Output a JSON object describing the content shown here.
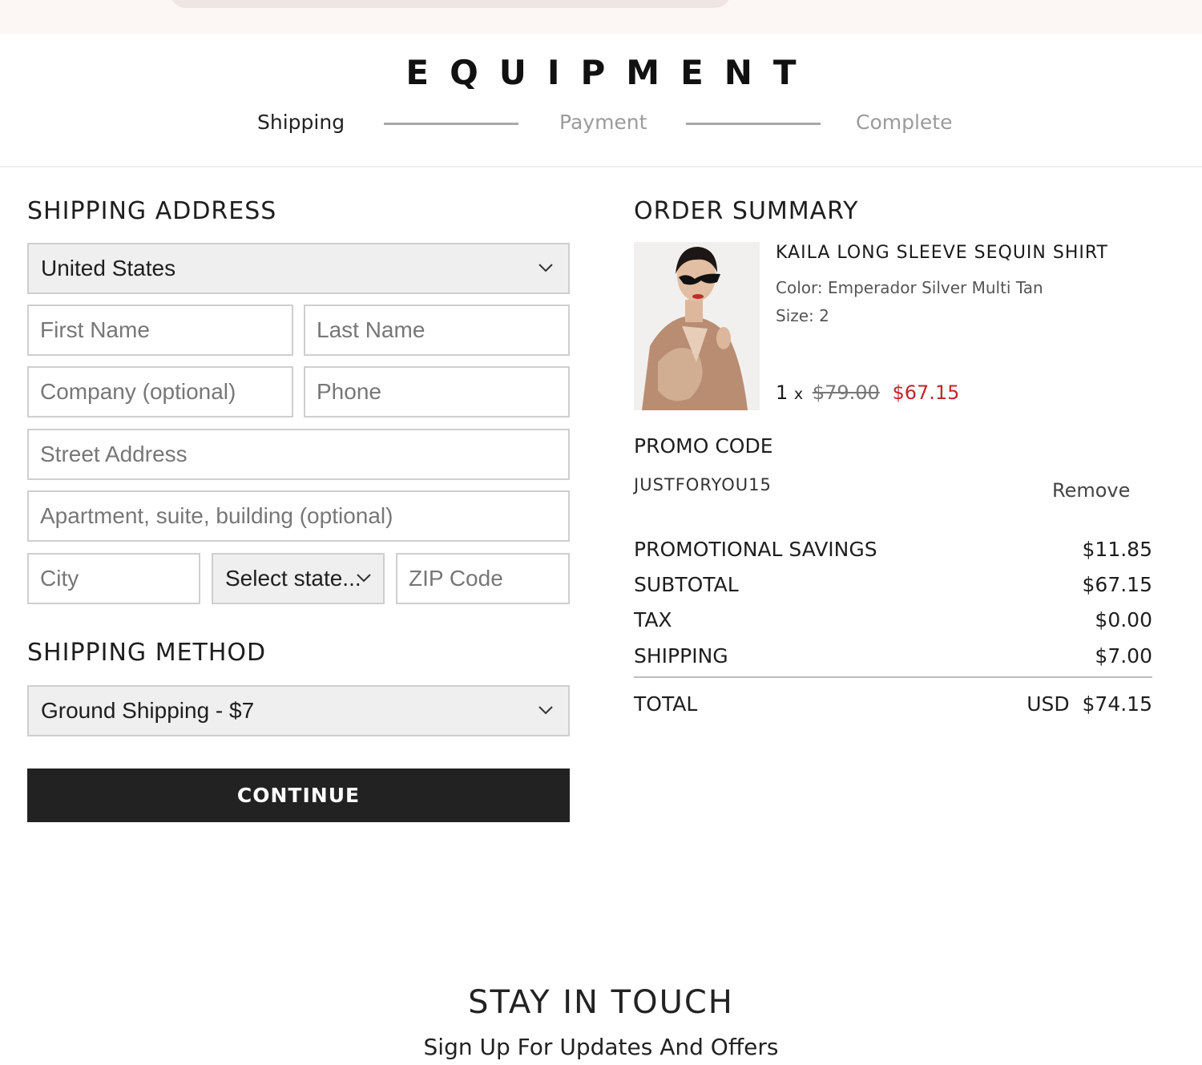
{
  "brand": {
    "logo": "EQUIPMENT"
  },
  "checkout_steps": [
    "Shipping",
    "Payment",
    "Complete"
  ],
  "shipping_address": {
    "heading": "SHIPPING ADDRESS",
    "country": "United States",
    "first_name_placeholder": "First Name",
    "last_name_placeholder": "Last Name",
    "company_placeholder": "Company (optional)",
    "phone_placeholder": "Phone",
    "street_placeholder": "Street Address",
    "apartment_placeholder": "Apartment, suite, building (optional)",
    "city_placeholder": "City",
    "state_value": "Select state...",
    "zip_placeholder": "ZIP Code"
  },
  "shipping_method": {
    "heading": "SHIPPING METHOD",
    "selected": "Ground Shipping - $7"
  },
  "continue_label": "CONTINUE",
  "order_summary": {
    "heading": "ORDER SUMMARY",
    "item": {
      "name": "KAILA LONG SLEEVE SEQUIN SHIRT",
      "color": "Color: Emperador Silver Multi Tan",
      "size": "Size: 2",
      "quantity": "1",
      "qty_separator": "x",
      "original_price": "$79.00",
      "sale_price": "$67.15"
    },
    "promo": {
      "heading": "PROMO CODE",
      "code": "JUSTFORYOU15",
      "remove_label": "Remove"
    },
    "rows": [
      {
        "label": "PROMOTIONAL SAVINGS",
        "value": "$11.85"
      },
      {
        "label": "SUBTOTAL",
        "value": "$67.15"
      },
      {
        "label": "TAX",
        "value": "$0.00"
      },
      {
        "label": "SHIPPING",
        "value": "$7.00"
      }
    ],
    "total": {
      "label": "TOTAL",
      "currency": "USD",
      "value": "$74.15"
    }
  },
  "footer": {
    "title": "STAY IN TOUCH",
    "subtitle": "Sign Up For Updates And Offers"
  },
  "colors": {
    "sale": "#c1272d",
    "button": "#222222",
    "select_bg": "#efefef",
    "topbar": "#fcf6f5"
  },
  "icons": [
    "chevron-down-icon"
  ]
}
